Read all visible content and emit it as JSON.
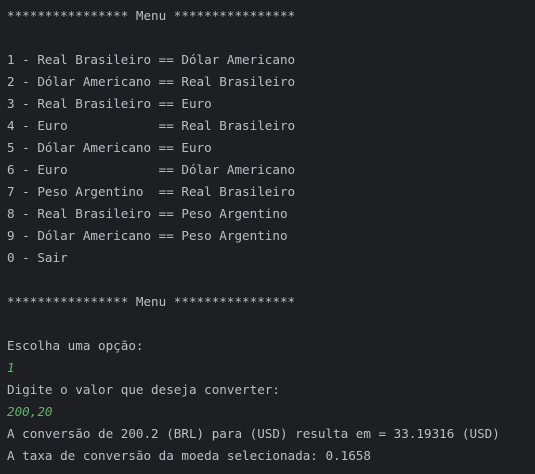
{
  "console": {
    "menu_header": "**************** Menu ****************",
    "options": [
      "1 - Real Brasileiro == Dólar Americano",
      "2 - Dólar Americano == Real Brasileiro",
      "3 - Real Brasileiro == Euro",
      "4 - Euro            == Real Brasileiro",
      "5 - Dólar Americano == Euro",
      "6 - Euro            == Dólar Americano",
      "7 - Peso Argentino  == Real Brasileiro",
      "8 - Real Brasileiro == Peso Argentino",
      "9 - Dólar Americano == Peso Argentino",
      "0 - Sair"
    ],
    "menu_footer": "**************** Menu ****************",
    "prompt_option": "Escolha uma opção:",
    "input_option": "1",
    "prompt_value": "Digite o valor que deseja converter:",
    "input_value": "200,20",
    "result_line": "A conversão de 200.2 (BRL) para (USD) resulta em = 33.19316 (USD)",
    "rate_line": "A taxa de conversão da moeda selecionada: 0.1658"
  },
  "colors": {
    "background": "#1e1f22",
    "text": "#bcbec4",
    "user_input": "#5fb865"
  }
}
